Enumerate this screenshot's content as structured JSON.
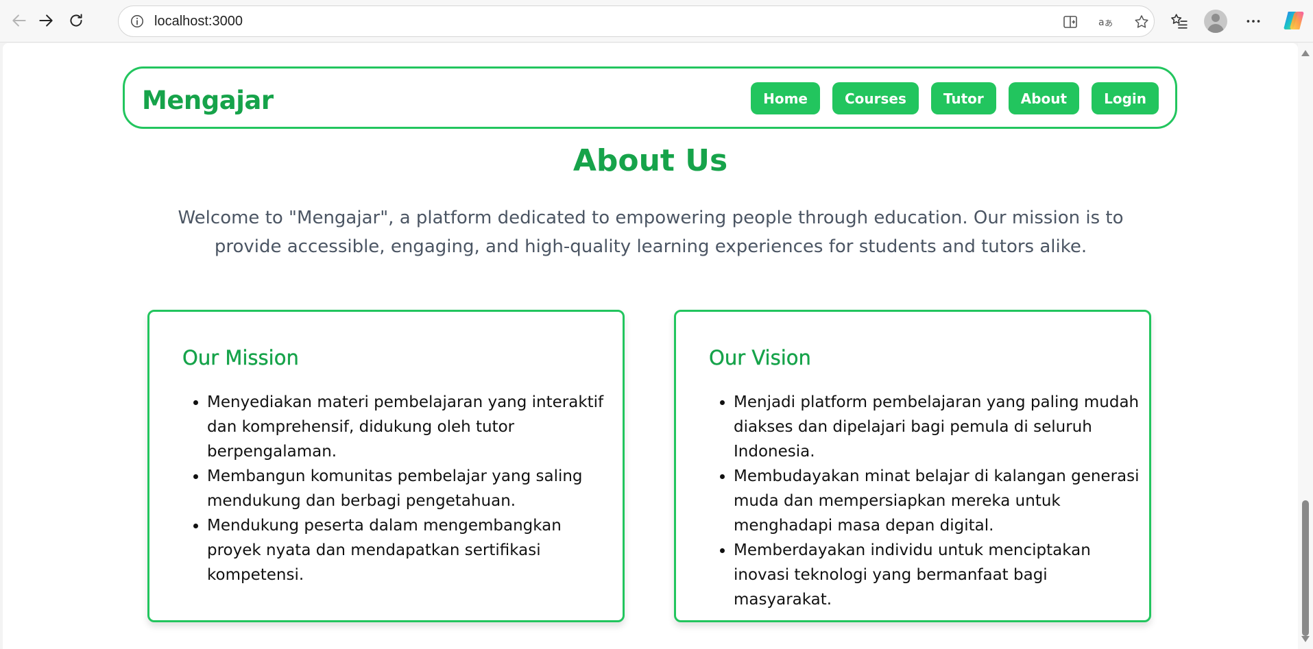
{
  "browser": {
    "url": "localhost:3000"
  },
  "site": {
    "brand": "Mengajar",
    "nav": [
      "Home",
      "Courses",
      "Tutor",
      "About",
      "Login"
    ]
  },
  "about": {
    "title": "About Us",
    "intro": "Welcome to \"Mengajar\", a platform dedicated to empowering people through education. Our mission is to provide accessible, engaging, and high-quality learning experiences for students and tutors alike."
  },
  "mission": {
    "title": "Our Mission",
    "items": [
      "Menyediakan materi pembelajaran yang interaktif dan komprehensif, didukung oleh tutor berpengalaman.",
      "Membangun komunitas pembelajar yang saling mendukung dan berbagi pengetahuan.",
      "Mendukung peserta dalam mengembangkan proyek nyata dan mendapatkan sertifikasi kompetensi."
    ]
  },
  "vision": {
    "title": "Our Vision",
    "items": [
      "Menjadi platform pembelajaran yang paling mudah diakses dan dipelajari bagi pemula di seluruh Indonesia.",
      "Membudayakan minat belajar di kalangan generasi muda dan mempersiapkan mereka untuk menghadapi masa depan digital.",
      "Memberdayakan individu untuk menciptakan inovasi teknologi yang bermanfaat bagi masyarakat."
    ]
  },
  "colors": {
    "brand_green": "#22c55e",
    "heading_green": "#16a34a",
    "body_gray": "#4b5563"
  },
  "icons": [
    "back-icon",
    "forward-icon",
    "refresh-icon",
    "site-info-icon",
    "split-screen-icon",
    "read-aloud-icon",
    "favorite-star-icon",
    "favorites-list-icon",
    "profile-avatar",
    "more-icon",
    "copilot-icon"
  ]
}
